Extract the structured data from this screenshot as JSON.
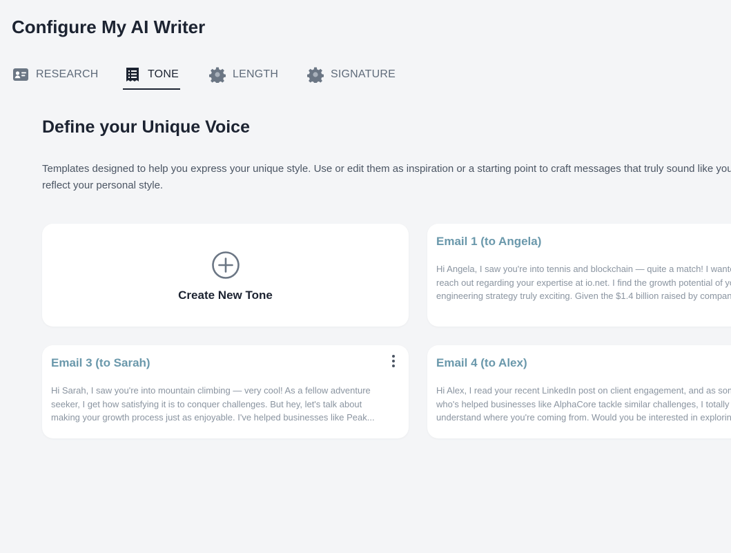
{
  "header": {
    "title": "Configure My AI Writer"
  },
  "tabs": [
    {
      "label": "RESEARCH",
      "icon": "id-card-icon",
      "active": false
    },
    {
      "label": "TONE",
      "icon": "receipt-list-icon",
      "active": true
    },
    {
      "label": "LENGTH",
      "icon": "gear-icon",
      "active": false
    },
    {
      "label": "SIGNATURE",
      "icon": "gear-icon",
      "active": false
    }
  ],
  "section": {
    "title": "Define your Unique Voice",
    "description": "Templates designed to help you express your unique style. Use or edit them as inspiration or a starting point to craft messages that truly sound like you and reflect your personal style."
  },
  "create_card": {
    "label": "Create New Tone",
    "icon": "plus-circle-icon"
  },
  "emails": [
    {
      "title": "Email 1 (to Angela)",
      "body": "Hi Angela, I saw you're into tennis and blockchain — quite a match! I wanted to reach out regarding your expertise at io.net. I find the growth potential of your engineering strategy truly exciting. Given the $1.4 billion raised by companies like yours..."
    },
    {
      "title": "Email 3 (to Sarah)",
      "body": "Hi Sarah, I saw you're into mountain climbing — very cool! As a fellow adventure seeker, I get how satisfying it is to conquer challenges. But hey, let's talk about making your growth process just as enjoyable. I've helped businesses like Peak..."
    },
    {
      "title": "Email 4 (to Alex)",
      "body": "Hi Alex, I read your recent LinkedIn post on client engagement, and as someone who's helped businesses like AlphaCore tackle similar challenges, I totally understand where you're coming from. Would you be interested in exploring how E..."
    }
  ],
  "colors": {
    "background": "#f4f5f7",
    "text_dark": "#1c2331",
    "tab_inactive": "#5f6b7a",
    "email_title": "#6a98ab",
    "email_body": "#8a94a0",
    "card": "#ffffff"
  }
}
